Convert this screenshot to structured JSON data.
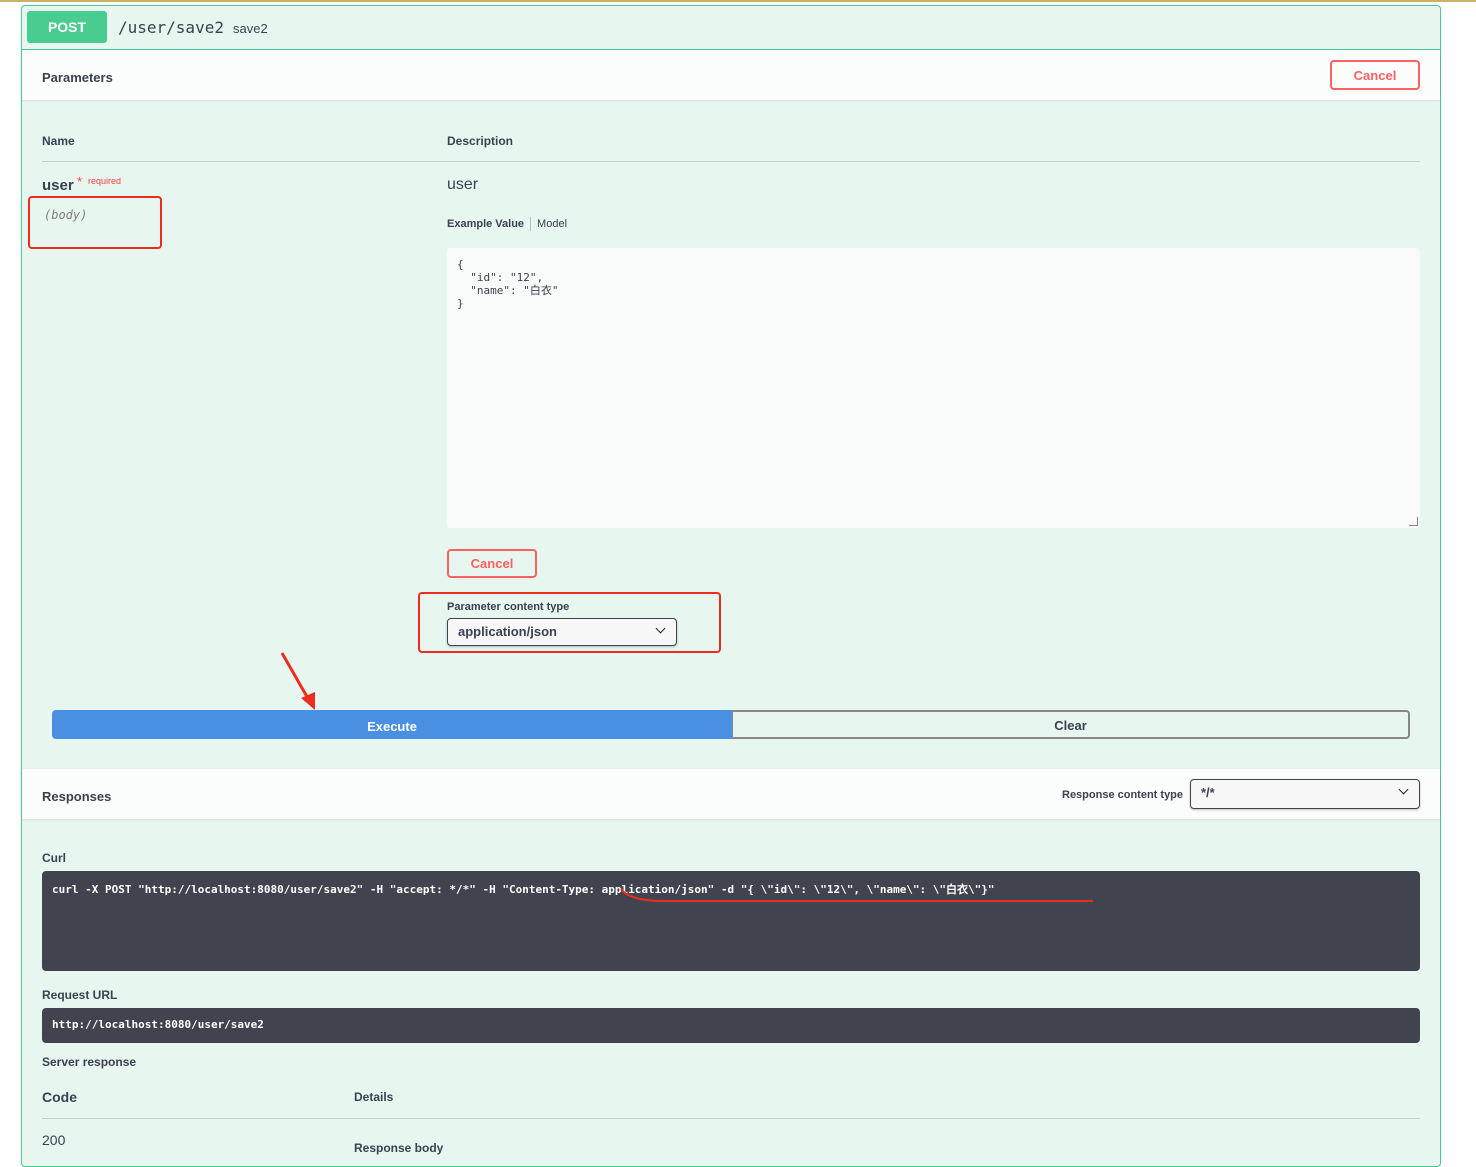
{
  "operation": {
    "method": "POST",
    "path": "/user/save2",
    "summary": "save2"
  },
  "parameters_section": {
    "title": "Parameters",
    "cancel_label": "Cancel"
  },
  "param_table": {
    "name_header": "Name",
    "description_header": "Description",
    "param": {
      "name": "user",
      "required_star": "*",
      "required_label": "required",
      "in": "(body)",
      "description": "user"
    },
    "example_tab": "Example Value",
    "model_tab": "Model",
    "body_value": "{\n  \"id\": \"12\",\n  \"name\": \"白衣\"\n}",
    "cancel_label": "Cancel",
    "content_type_label": "Parameter content type",
    "content_type_value": "application/json"
  },
  "actions": {
    "execute_label": "Execute",
    "clear_label": "Clear"
  },
  "responses_section": {
    "title": "Responses",
    "content_type_label": "Response content type",
    "content_type_value": "*/*"
  },
  "curl": {
    "label": "Curl",
    "command": "curl -X POST \"http://localhost:8080/user/save2\" -H \"accept: */*\" -H \"Content-Type: application/json\" -d \"{ \\\"id\\\": \\\"12\\\", \\\"name\\\": \\\"白衣\\\"}\""
  },
  "request_url": {
    "label": "Request URL",
    "value": "http://localhost:8080/user/save2"
  },
  "server_response": {
    "label": "Server response",
    "code_header": "Code",
    "details_header": "Details",
    "code": "200",
    "response_body_label": "Response body"
  },
  "annotation_color": "#ec2d1e",
  "accent_colors": {
    "post": "#49cc90",
    "execute": "#4990e2",
    "cancel": "#ff6060"
  }
}
